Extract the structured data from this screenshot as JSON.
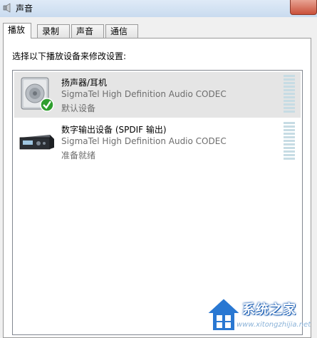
{
  "window": {
    "title": "声音"
  },
  "tabs": [
    {
      "label": "播放",
      "active": true
    },
    {
      "label": "录制",
      "active": false
    },
    {
      "label": "声音",
      "active": false
    },
    {
      "label": "通信",
      "active": false
    }
  ],
  "playback": {
    "instruction": "选择以下播放设备来修改设置:",
    "devices": [
      {
        "name": "扬声器/耳机",
        "driver": "SigmaTel High Definition Audio CODEC",
        "status": "默认设备",
        "icon": "speaker-icon",
        "selected": true,
        "default": true
      },
      {
        "name": "数字输出设备 (SPDIF 输出)",
        "driver": "SigmaTel High Definition Audio CODEC",
        "status": "准备就绪",
        "icon": "digital-output-icon",
        "selected": false,
        "default": false
      }
    ]
  },
  "watermark": {
    "text": "系统之家",
    "url": "www.xitongzhijia.net"
  },
  "colors": {
    "window_frame": "#d7e4f2",
    "selection": "#e5e5e5",
    "meter": "#c7dce4",
    "check": "#2e9e2e"
  }
}
